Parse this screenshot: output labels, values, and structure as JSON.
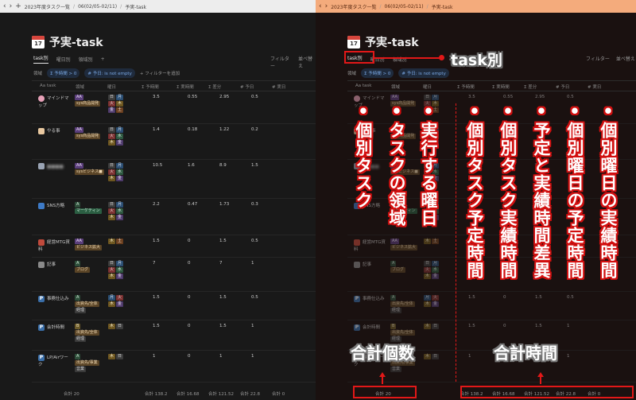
{
  "breadcrumb": {
    "workspace": "2023年度タスク一覧",
    "period": "06(02/05-02/11)",
    "page": "予実-task"
  },
  "page": {
    "title": "予実-task",
    "calendar_day": "17"
  },
  "views": {
    "tabs": [
      "task別",
      "曜日別",
      "領域別"
    ],
    "add": "+",
    "filter_label": "フィルター",
    "sort_label": "並べ替え"
  },
  "filters": {
    "area_chip": "領域",
    "chip1": "Σ 予時間 > 0",
    "chip2": "# 予日: is not empty",
    "add_filter": "+ フィルターを追加"
  },
  "columns": [
    "Aa task",
    "領域",
    "曜日",
    "Σ 予時間",
    "Σ 実時間",
    "Σ 差分",
    "# 予日",
    "# 実日"
  ],
  "rows": [
    {
      "icon": "brain",
      "name": "マインドマップ",
      "lvl": "AA",
      "area": "sys商品開発",
      "days": [
        "日",
        "月",
        "火",
        "木",
        "金",
        "土"
      ],
      "plan": "3.5",
      "actual": "0.55",
      "diff": "2.95",
      "pd": "0.5",
      "ad": ""
    },
    {
      "icon": "pink",
      "name": "やる事",
      "lvl": "AA",
      "area": "sys商品開発",
      "days": [
        "日",
        "月",
        "火",
        "水",
        "木",
        "金"
      ],
      "plan": "1.4",
      "actual": "0.18",
      "diff": "1.22",
      "pd": "0.2",
      "ad": ""
    },
    {
      "icon": "doc",
      "name": "■■■■",
      "blur": true,
      "lvl": "AA",
      "area": "sysビジネス■",
      "days": [
        "日",
        "月",
        "火",
        "水",
        "木",
        "金"
      ],
      "plan": "10.5",
      "actual": "1.6",
      "diff": "8.9",
      "pd": "1.5",
      "ad": ""
    },
    {
      "icon": "blue",
      "name": "SNS方略",
      "lvl": "A",
      "area": "マーケティン",
      "days": [
        "日",
        "月",
        "火",
        "水",
        "木",
        "金"
      ],
      "plan": "2.2",
      "actual": "0.47",
      "diff": "1.73",
      "pd": "0.3",
      "ad": ""
    },
    {
      "icon": "cal",
      "name": "経営MTG資料",
      "lvl": "AA",
      "area": "ビジネス拡大",
      "days": [
        "木",
        "土"
      ],
      "plan": "1.5",
      "actual": "0",
      "diff": "1.5",
      "pd": "0.5",
      "ad": ""
    },
    {
      "icon": "list",
      "name": "記事",
      "lvl": "A",
      "area": "ブログ",
      "days": [
        "日",
        "月",
        "火",
        "水",
        "木",
        "金"
      ],
      "plan": "7",
      "actual": "0",
      "diff": "7",
      "pd": "1",
      "ad": ""
    },
    {
      "icon": "p",
      "name": "事務仕込み",
      "lvl": "A",
      "area": "出資先/全体",
      "area2": "経理",
      "days": [
        "月",
        "火",
        "木",
        "金"
      ],
      "plan": "1.5",
      "actual": "0",
      "diff": "1.5",
      "pd": "0.5",
      "ad": ""
    },
    {
      "icon": "p",
      "name": "会計時間",
      "lvl": "B",
      "area": "出資先/全体",
      "area2": "経理",
      "days": [
        "木",
        "日"
      ],
      "plan": "1.5",
      "actual": "0",
      "diff": "1.5",
      "pd": "1",
      "ad": ""
    },
    {
      "icon": "p",
      "name": "LP/Airワーク",
      "lvl": "A",
      "area": "出資先/事業",
      "area2": "営業",
      "days": [
        "木",
        "日"
      ],
      "plan": "1",
      "actual": "0",
      "diff": "1",
      "pd": "1",
      "ad": ""
    }
  ],
  "footer": {
    "count_label": "合計",
    "count": "20",
    "sum_label": "合計",
    "plan_total": "138.2",
    "actual_total": "16.68",
    "diff_total": "121.52",
    "pd_total": "22.8",
    "ad_total": "0"
  },
  "annotations": {
    "task_label": "task別",
    "col_task": "•個別タスク",
    "col_area": "•タスクの領域",
    "col_days": "•実行する曜日",
    "col_plan": "•個別タスク予定時間",
    "col_actual": "•個別タスク実績時間",
    "col_diff": "•予定と実績時間差異",
    "col_pd": "•個別曜日の予定時間",
    "col_ad": "•個別曜日の実績時間",
    "count_note": "合計個数",
    "total_note": "合計時間"
  },
  "colors": {
    "accent_red": "#e21818",
    "topbar_right": "#f4ab7c"
  }
}
